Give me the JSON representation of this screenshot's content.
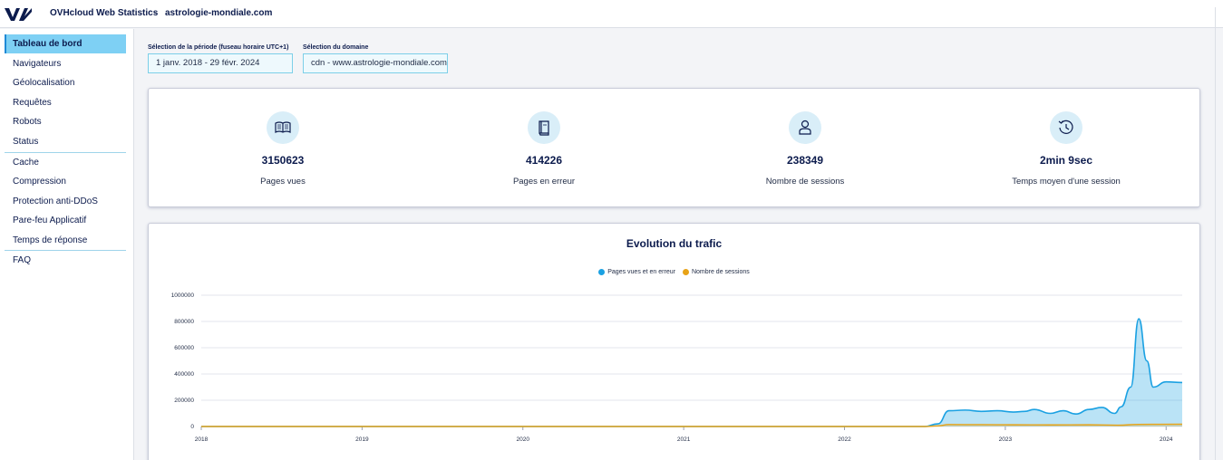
{
  "header": {
    "app_title": "OVHcloud Web Statistics",
    "separator": "-",
    "domain": "astrologie-mondiale.com"
  },
  "sidebar": {
    "items": [
      {
        "label": "Tableau de bord",
        "active": true
      },
      {
        "label": "Navigateurs"
      },
      {
        "label": "Géolocalisation"
      },
      {
        "label": "Requêtes"
      },
      {
        "label": "Robots"
      },
      {
        "label": "Status"
      },
      {
        "label": "Cache"
      },
      {
        "label": "Compression"
      },
      {
        "label": "Protection anti-DDoS"
      },
      {
        "label": "Pare-feu Applicatif"
      },
      {
        "label": "Temps de réponse"
      },
      {
        "label": "FAQ"
      }
    ]
  },
  "filters": {
    "period_label": "Sélection de la période (fuseau horaire UTC+1)",
    "period_value": "1 janv. 2018 - 29 févr. 2024",
    "domain_label": "Sélection du domaine",
    "domain_value": "cdn - www.astrologie-mondiale.com"
  },
  "stats": [
    {
      "icon": "book-open-icon",
      "value": "3150623",
      "label": "Pages vues"
    },
    {
      "icon": "broken-book-icon",
      "value": "414226",
      "label": "Pages en erreur"
    },
    {
      "icon": "user-icon",
      "value": "238349",
      "label": "Nombre de sessions"
    },
    {
      "icon": "clock-icon",
      "value": "2min 9sec",
      "label": "Temps moyen d'une session"
    }
  ],
  "colors": {
    "accent": "#7ed0f4",
    "series_pages": "#1ba1e2",
    "series_sessions": "#e8a317",
    "brand": "#0c1b4d"
  },
  "chart_data": {
    "type": "area",
    "title": "Evolution du trafic",
    "xlabel": "",
    "ylabel": "",
    "x_ticks": [
      "2018",
      "2019",
      "2020",
      "2021",
      "2022",
      "2023",
      "2024"
    ],
    "y_ticks": [
      "1000000",
      "800000",
      "600000",
      "400000",
      "200000",
      "0"
    ],
    "xlim": [
      2018.0,
      2024.1
    ],
    "ylim": [
      0,
      1000000
    ],
    "grid": true,
    "legend_position": "top-center",
    "series": [
      {
        "name": "Pages vues et en erreur",
        "color": "#1ba1e2",
        "points": [
          [
            2018.0,
            0
          ],
          [
            2022.5,
            0
          ],
          [
            2022.58,
            20000
          ],
          [
            2022.65,
            120000
          ],
          [
            2022.75,
            125000
          ],
          [
            2022.85,
            115000
          ],
          [
            2022.95,
            120000
          ],
          [
            2023.05,
            110000
          ],
          [
            2023.12,
            115000
          ],
          [
            2023.18,
            130000
          ],
          [
            2023.28,
            100000
          ],
          [
            2023.36,
            120000
          ],
          [
            2023.44,
            95000
          ],
          [
            2023.52,
            130000
          ],
          [
            2023.6,
            145000
          ],
          [
            2023.68,
            100000
          ],
          [
            2023.72,
            150000
          ],
          [
            2023.78,
            300000
          ],
          [
            2023.83,
            820000
          ],
          [
            2023.88,
            500000
          ],
          [
            2023.92,
            300000
          ],
          [
            2024.0,
            340000
          ],
          [
            2024.1,
            335000
          ]
        ]
      },
      {
        "name": "Nombre de sessions",
        "color": "#e8a317",
        "points": [
          [
            2018.0,
            0
          ],
          [
            2022.5,
            0
          ],
          [
            2022.58,
            5000
          ],
          [
            2022.65,
            15000
          ],
          [
            2022.85,
            14000
          ],
          [
            2023.05,
            13000
          ],
          [
            2023.28,
            12000
          ],
          [
            2023.52,
            13000
          ],
          [
            2023.7,
            10000
          ],
          [
            2023.83,
            16000
          ],
          [
            2024.1,
            18000
          ]
        ]
      }
    ]
  }
}
